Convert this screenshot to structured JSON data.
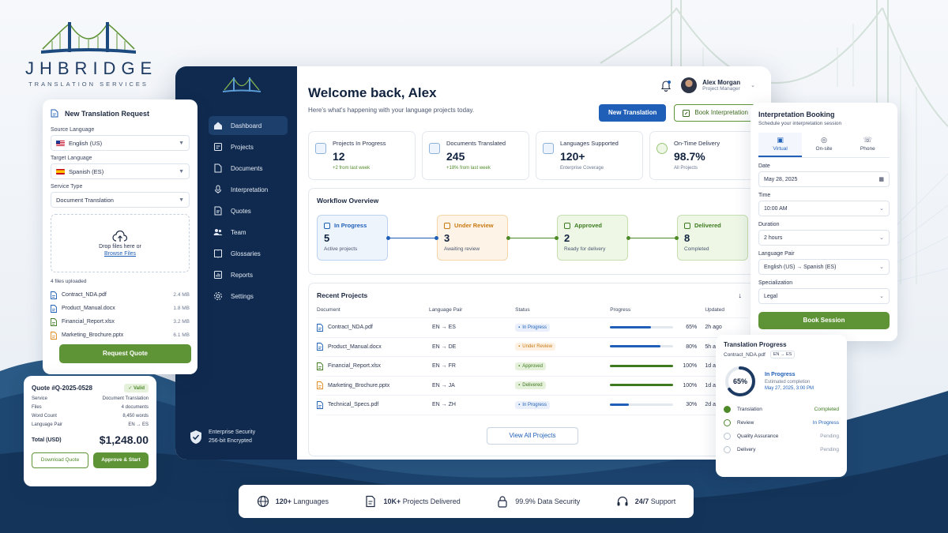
{
  "brand": {
    "name": "JHBRIDGE",
    "tagline": "TRANSLATION SERVICES"
  },
  "colors": {
    "navy": "#0f2a4e",
    "blue": "#1f5fb7",
    "green": "#5f9436",
    "orange": "#e08a1e"
  },
  "request": {
    "title": "New Translation Request",
    "source_label": "Source Language",
    "source_value": "English (US)",
    "target_label": "Target Language",
    "target_value": "Spanish (ES)",
    "service_label": "Service Type",
    "service_value": "Document Translation",
    "drop_text": "Drop files here or",
    "browse": "Browse Files",
    "files_count": "4 files uploaded",
    "files": [
      {
        "name": "Contract_NDA.pdf",
        "size": "2.4 MB",
        "type": "pdf"
      },
      {
        "name": "Product_Manual.docx",
        "size": "1.8 MB",
        "type": "docx"
      },
      {
        "name": "Financial_Report.xlsx",
        "size": "3.2 MB",
        "type": "xlsx"
      },
      {
        "name": "Marketing_Brochure.pptx",
        "size": "6.1 MB",
        "type": "pptx"
      }
    ],
    "cta": "Request Quote"
  },
  "quote": {
    "title": "Quote #Q-2025-0528",
    "status": "Valid",
    "rows": [
      {
        "k": "Service",
        "v": "Document Translation"
      },
      {
        "k": "Files",
        "v": "4 documents"
      },
      {
        "k": "Word Count",
        "v": "8,450 words"
      },
      {
        "k": "Language Pair",
        "v": "EN → ES"
      }
    ],
    "total_label": "Total (USD)",
    "total": "$1,248.00",
    "download": "Download Quote",
    "approve": "Approve & Start"
  },
  "sidebar": {
    "items": [
      {
        "label": "Dashboard",
        "icon": "home-icon",
        "active": true
      },
      {
        "label": "Projects",
        "icon": "projects-icon"
      },
      {
        "label": "Documents",
        "icon": "documents-icon"
      },
      {
        "label": "Interpretation",
        "icon": "microphone-icon"
      },
      {
        "label": "Quotes",
        "icon": "quotes-icon"
      },
      {
        "label": "Team",
        "icon": "team-icon"
      },
      {
        "label": "Glossaries",
        "icon": "book-icon"
      },
      {
        "label": "Reports",
        "icon": "reports-icon"
      },
      {
        "label": "Settings",
        "icon": "gear-icon"
      }
    ],
    "security_title": "Enterprise Security",
    "security_sub": "256-bit Encrypted"
  },
  "header": {
    "welcome": "Welcome back, Alex",
    "subtitle": "Here's what's happening with your language projects today.",
    "user_name": "Alex Morgan",
    "user_role": "Project Manager",
    "new_translation": "New Translation",
    "book_interpretation": "Book Interpretation"
  },
  "stats": [
    {
      "label": "Projects In Progress",
      "value": "12",
      "delta": "+2 from last week"
    },
    {
      "label": "Documents Translated",
      "value": "245",
      "delta": "+18% from last week"
    },
    {
      "label": "Languages Supported",
      "value": "120+",
      "delta": "Enterprise Coverage"
    },
    {
      "label": "On-Time Delivery",
      "value": "98.7%",
      "delta": "All Projects"
    }
  ],
  "workflow": {
    "title": "Workflow Overview",
    "stages": [
      {
        "label": "In Progress",
        "value": "5",
        "sub": "Active projects"
      },
      {
        "label": "Under Review",
        "value": "3",
        "sub": "Awaiting review"
      },
      {
        "label": "Approved",
        "value": "2",
        "sub": "Ready for delivery"
      },
      {
        "label": "Delivered",
        "value": "8",
        "sub": "Completed"
      }
    ]
  },
  "recent": {
    "title": "Recent Projects",
    "columns": [
      "Document",
      "Language Pair",
      "Status",
      "Progress",
      "Updated"
    ],
    "rows": [
      {
        "doc": "Contract_NDA.pdf",
        "pair": "EN  →  ES",
        "status": "In Progress",
        "status_key": "ip",
        "progress": 65,
        "pct": "65%",
        "updated": "2h ago",
        "type": "pdf"
      },
      {
        "doc": "Product_Manual.docx",
        "pair": "EN  →  DE",
        "status": "Under Review",
        "status_key": "ur",
        "progress": 80,
        "pct": "80%",
        "updated": "5h ago",
        "type": "docx"
      },
      {
        "doc": "Financial_Report.xlsx",
        "pair": "EN  →  FR",
        "status": "Approved",
        "status_key": "ap",
        "progress": 100,
        "pct": "100%",
        "updated": "1d ago",
        "type": "xlsx"
      },
      {
        "doc": "Marketing_Brochure.pptx",
        "pair": "EN  →  JA",
        "status": "Delivered",
        "status_key": "dl",
        "progress": 100,
        "pct": "100%",
        "updated": "1d ago",
        "type": "pptx"
      },
      {
        "doc": "Technical_Specs.pdf",
        "pair": "EN  →  ZH",
        "status": "In Progress",
        "status_key": "ip",
        "progress": 30,
        "pct": "30%",
        "updated": "2d ago",
        "type": "pdf"
      }
    ],
    "view_all": "View All Projects"
  },
  "booking": {
    "title": "Interpretation Booking",
    "subtitle": "Schedule your interpretation session",
    "tabs": [
      "Virtual",
      "On-site",
      "Phone"
    ],
    "date_label": "Date",
    "date_value": "May 28, 2025",
    "time_label": "Time",
    "time_value": "10:00 AM",
    "duration_label": "Duration",
    "duration_value": "2 hours",
    "pair_label": "Language Pair",
    "pair_value": "English (US) → Spanish (ES)",
    "spec_label": "Specialization",
    "spec_value": "Legal",
    "cta": "Book Session"
  },
  "progress": {
    "title": "Translation Progress",
    "file": "Contract_NDA.pdf",
    "pair": "EN → ES",
    "percent": 65,
    "percent_label": "65%",
    "status": "In Progress",
    "est_label": "Estimated completion",
    "est_value": "May 27, 2025, 3:00 PM",
    "steps": [
      {
        "label": "Translation",
        "status": "Completed",
        "state": "done"
      },
      {
        "label": "Review",
        "status": "In Progress",
        "state": "prog"
      },
      {
        "label": "Quality Assurance",
        "status": "Pending",
        "state": "pend"
      },
      {
        "label": "Delivery",
        "status": "Pending",
        "state": "pend"
      }
    ]
  },
  "features": [
    {
      "strong": "120+",
      "text": " Languages",
      "icon": "globe-icon"
    },
    {
      "strong": "10K+",
      "text": " Projects Delivered",
      "icon": "document-icon"
    },
    {
      "strong": "",
      "text": "99.9% Data Security",
      "icon": "lock-icon"
    },
    {
      "strong": "24/7",
      "text": " Support",
      "icon": "headset-icon"
    }
  ]
}
